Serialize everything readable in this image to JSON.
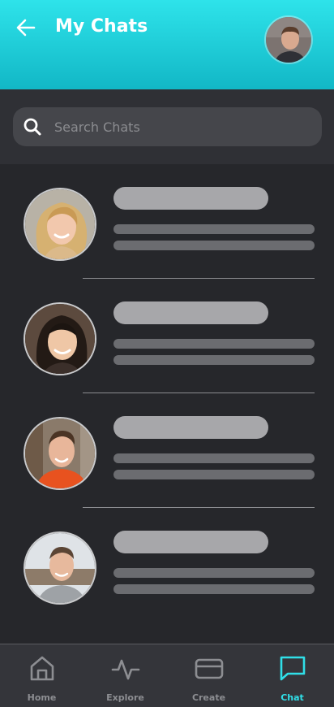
{
  "header": {
    "title": "My Chats",
    "back_icon": "arrow-left-icon",
    "avatar": "profile-avatar"
  },
  "search": {
    "placeholder": "Search Chats",
    "icon": "search-icon"
  },
  "chats": [
    {
      "avatar": "avatar-blonde-woman",
      "skeleton": true
    },
    {
      "avatar": "avatar-dark-haired-woman",
      "skeleton": true
    },
    {
      "avatar": "avatar-man-orange-sweater",
      "skeleton": true
    },
    {
      "avatar": "avatar-man-grey-shirt",
      "skeleton": true
    }
  ],
  "nav": {
    "items": [
      {
        "label": "Home",
        "icon": "home-icon"
      },
      {
        "label": "Explore",
        "icon": "activity-icon"
      },
      {
        "label": "Create",
        "icon": "card-icon"
      },
      {
        "label": "Chat",
        "icon": "chat-icon"
      }
    ],
    "active": "Chat"
  },
  "colors": {
    "accent": "#30dfe8",
    "header_top": "#2ee3ea",
    "header_bottom": "#12b7c6",
    "background": "#26272b",
    "skeleton_title": "#a7a7aa",
    "skeleton_line": "#6b6c70"
  }
}
